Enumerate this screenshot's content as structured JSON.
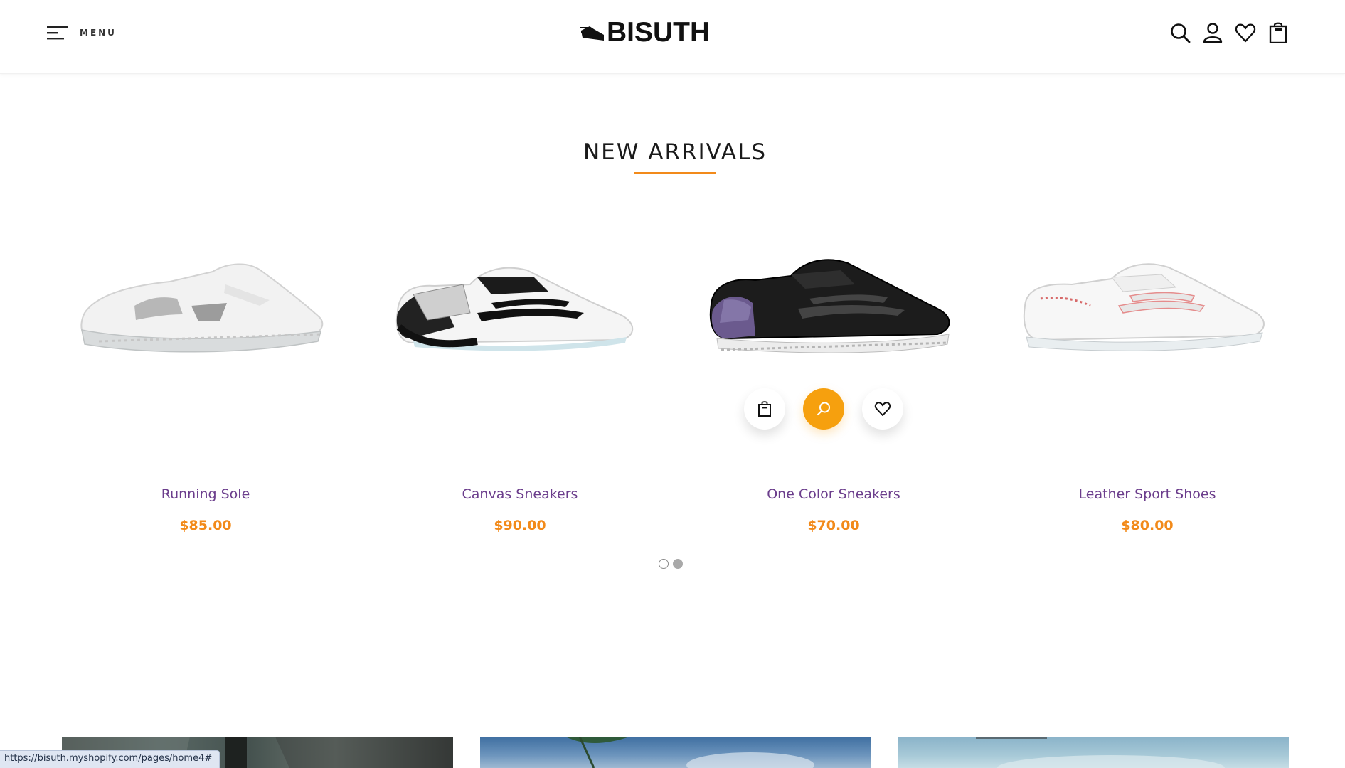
{
  "header": {
    "menu_label": "MENU",
    "logo_text": "BISUTH",
    "icons": [
      "search-icon",
      "account-icon",
      "wishlist-heart-icon",
      "cart-bag-icon"
    ]
  },
  "section": {
    "title": "NEW ARRIVALS"
  },
  "products": [
    {
      "name": "Running Sole",
      "price": "$85.00"
    },
    {
      "name": "Canvas Sneakers",
      "price": "$90.00"
    },
    {
      "name": "One Color Sneakers",
      "price": "$70.00"
    },
    {
      "name": "Leather Sport Shoes",
      "price": "$80.00"
    }
  ],
  "product_actions": [
    "add-to-cart-icon",
    "quick-view-search-icon",
    "wishlist-heart-icon"
  ],
  "slider": {
    "pages": 2,
    "active": 2
  },
  "status_bar": {
    "url": "https://bisuth.myshopify.com/pages/home4#"
  },
  "colors": {
    "accent_orange": "#f28a1a",
    "action_orange": "#f6a00e",
    "product_name_purple": "#6b3d8c"
  }
}
